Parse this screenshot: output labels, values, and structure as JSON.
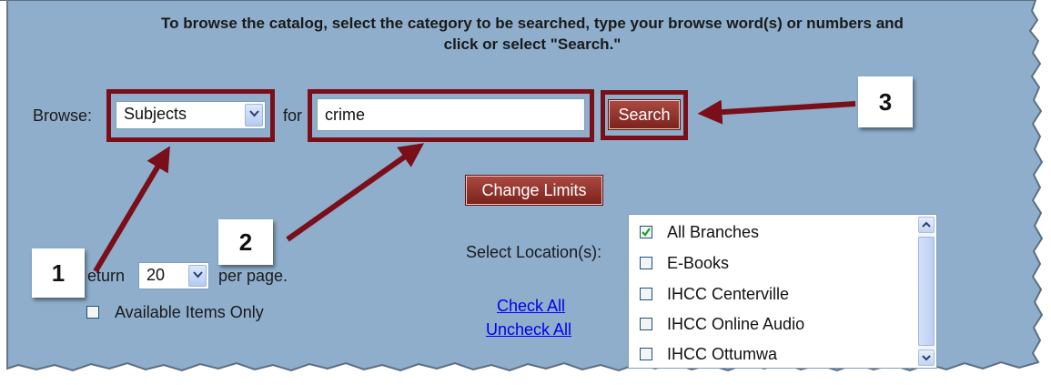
{
  "instruction": {
    "line1": "To browse the catalog, select the category to be searched, type your browse word(s) or numbers and",
    "line2": "click or select \"Search.\""
  },
  "browse": {
    "label": "Browse:",
    "category_selected": "Subjects",
    "for_label": "for",
    "query_value": "crime",
    "search_label": "Search"
  },
  "limits": {
    "change_limits_label": "Change Limits"
  },
  "results": {
    "return_label": "eturn",
    "per_page_value": "20",
    "per_page_label": "per page.",
    "available_only_label": "Available Items Only",
    "available_only_checked": false
  },
  "location": {
    "label": "Select Location(s):",
    "check_all": "Check All",
    "uncheck_all": "Uncheck All",
    "options": [
      {
        "label": "All Branches",
        "checked": true
      },
      {
        "label": "E-Books",
        "checked": false
      },
      {
        "label": "IHCC Centerville",
        "checked": false
      },
      {
        "label": "IHCC Online Audio",
        "checked": false
      },
      {
        "label": "IHCC Ottumwa",
        "checked": false
      }
    ]
  },
  "callouts": {
    "one": "1",
    "two": "2",
    "three": "3"
  },
  "colors": {
    "panel": "#8eaecc",
    "highlight": "#7a0f1a",
    "button": "#8b2b24",
    "link": "#0000ee"
  },
  "icons": [
    "chevron-down-icon",
    "chevron-up-icon",
    "checkmark-icon",
    "arrow-icon"
  ]
}
